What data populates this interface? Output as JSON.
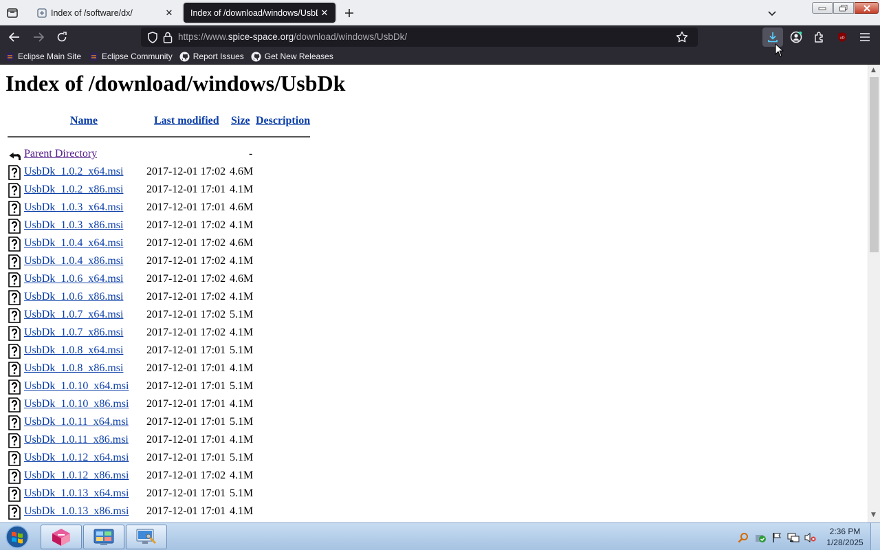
{
  "browser": {
    "tabs": [
      {
        "title": "Index of /software/dx/",
        "active": false
      },
      {
        "title": "Index of /download/windows/UsbD",
        "active": true
      }
    ],
    "url": {
      "scheme": "https://www.",
      "host": "spice-space.org",
      "path": "/download/windows/UsbDk/"
    },
    "bookmarks": [
      {
        "label": "Eclipse Main Site",
        "icon": "eclipse-icon"
      },
      {
        "label": "Eclipse Community",
        "icon": "eclipse-icon"
      },
      {
        "label": "Report Issues",
        "icon": "github-icon"
      },
      {
        "label": "Get New Releases",
        "icon": "github-icon"
      }
    ]
  },
  "page": {
    "heading": "Index of /download/windows/UsbDk",
    "columns": {
      "name": "Name",
      "modified": "Last modified",
      "size": "Size",
      "description": "Description"
    },
    "parent": {
      "name": "Parent Directory",
      "size": "-"
    },
    "files": [
      {
        "name": "UsbDk_1.0.2_x64.msi",
        "modified": "2017-12-01 17:02",
        "size": "4.6M"
      },
      {
        "name": "UsbDk_1.0.2_x86.msi",
        "modified": "2017-12-01 17:01",
        "size": "4.1M"
      },
      {
        "name": "UsbDk_1.0.3_x64.msi",
        "modified": "2017-12-01 17:01",
        "size": "4.6M"
      },
      {
        "name": "UsbDk_1.0.3_x86.msi",
        "modified": "2017-12-01 17:02",
        "size": "4.1M"
      },
      {
        "name": "UsbDk_1.0.4_x64.msi",
        "modified": "2017-12-01 17:02",
        "size": "4.6M"
      },
      {
        "name": "UsbDk_1.0.4_x86.msi",
        "modified": "2017-12-01 17:02",
        "size": "4.1M"
      },
      {
        "name": "UsbDk_1.0.6_x64.msi",
        "modified": "2017-12-01 17:02",
        "size": "4.6M"
      },
      {
        "name": "UsbDk_1.0.6_x86.msi",
        "modified": "2017-12-01 17:02",
        "size": "4.1M"
      },
      {
        "name": "UsbDk_1.0.7_x64.msi",
        "modified": "2017-12-01 17:02",
        "size": "5.1M"
      },
      {
        "name": "UsbDk_1.0.7_x86.msi",
        "modified": "2017-12-01 17:02",
        "size": "4.1M"
      },
      {
        "name": "UsbDk_1.0.8_x64.msi",
        "modified": "2017-12-01 17:01",
        "size": "5.1M"
      },
      {
        "name": "UsbDk_1.0.8_x86.msi",
        "modified": "2017-12-01 17:01",
        "size": "4.1M"
      },
      {
        "name": "UsbDk_1.0.10_x64.msi",
        "modified": "2017-12-01 17:01",
        "size": "5.1M"
      },
      {
        "name": "UsbDk_1.0.10_x86.msi",
        "modified": "2017-12-01 17:01",
        "size": "4.1M"
      },
      {
        "name": "UsbDk_1.0.11_x64.msi",
        "modified": "2017-12-01 17:01",
        "size": "5.1M"
      },
      {
        "name": "UsbDk_1.0.11_x86.msi",
        "modified": "2017-12-01 17:01",
        "size": "4.1M"
      },
      {
        "name": "UsbDk_1.0.12_x64.msi",
        "modified": "2017-12-01 17:01",
        "size": "5.1M"
      },
      {
        "name": "UsbDk_1.0.12_x86.msi",
        "modified": "2017-12-01 17:02",
        "size": "4.1M"
      },
      {
        "name": "UsbDk_1.0.13_x64.msi",
        "modified": "2017-12-01 17:01",
        "size": "5.1M"
      },
      {
        "name": "UsbDk_1.0.13_x86.msi",
        "modified": "2017-12-01 17:01",
        "size": "4.1M"
      }
    ]
  },
  "taskbar": {
    "apps": [
      "app-pink-cube-icon",
      "control-panel-icon",
      "network-setup-icon"
    ],
    "clock": {
      "time": "2:36 PM",
      "date": "1/28/2025"
    }
  },
  "colors": {
    "link": "#0b3ea8",
    "visited": "#551a8b",
    "toolbar": "#2b2a33",
    "active_tab": "#1c1b22"
  }
}
